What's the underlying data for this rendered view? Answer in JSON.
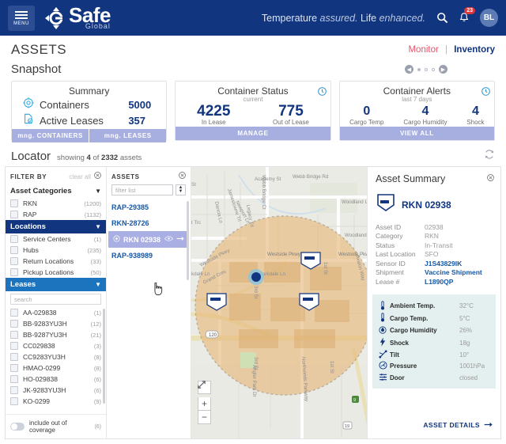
{
  "header": {
    "menu_label": "MENU",
    "logo_text": "Safe",
    "logo_sub": "Global",
    "tagline_1": "Temperature ",
    "tagline_2": "assured.",
    "tagline_3": " Life ",
    "tagline_4": "enhanced.",
    "search_icon": "search-icon",
    "bell_icon": "bell-icon",
    "notification_count": "23",
    "avatar_initials": "BL",
    "brand_navy": "#12357f"
  },
  "page": {
    "title": "ASSETS",
    "nav": {
      "monitor": "Monitor",
      "separator": "|",
      "inventory": "Inventory"
    },
    "snapshot_title": "Snapshot"
  },
  "cards": {
    "summary": {
      "title": "Summary",
      "rows": [
        {
          "label": "Containers",
          "value": "5000",
          "icon": "target-icon"
        },
        {
          "label": "Active Leases",
          "value": "357",
          "icon": "document-check-icon"
        }
      ],
      "actions": [
        "mng. CONTAINERS",
        "mng. LEASES"
      ]
    },
    "container_status": {
      "title": "Container Status",
      "subtitle": "current",
      "stats": [
        {
          "value": "4225",
          "label": "In Lease"
        },
        {
          "value": "775",
          "label": "Out of Lease"
        }
      ],
      "action": "MANAGE"
    },
    "container_alerts": {
      "title": "Container Alerts",
      "subtitle": "last 7 days",
      "stats": [
        {
          "value": "0",
          "label": "Cargo Temp"
        },
        {
          "value": "4",
          "label": "Cargo Humidity"
        },
        {
          "value": "4",
          "label": "Shock"
        }
      ],
      "action": "VIEW ALL"
    }
  },
  "locator": {
    "title": "Locator",
    "showing_prefix": "showing ",
    "showing_count": "4",
    "showing_mid": " of ",
    "showing_total": "2332",
    "showing_suffix": " assets",
    "refresh_icon": "refresh-icon"
  },
  "filter_panel": {
    "heading": "FILTER BY",
    "clear_all": "clear all",
    "close_icon": "close-circle-icon",
    "sections": [
      {
        "title": "Asset Categories",
        "style": "plain",
        "items": [
          {
            "label": "RKN",
            "count": "(1200)"
          },
          {
            "label": "RAP",
            "count": "(1132)"
          }
        ]
      },
      {
        "title": "Locations",
        "style": "navy",
        "items": [
          {
            "label": "Service Centers",
            "count": "(1)"
          },
          {
            "label": "Hubs",
            "count": "(235)"
          },
          {
            "label": "Return Locations",
            "count": "(33)"
          },
          {
            "label": "Pickup Locations",
            "count": "(50)"
          }
        ]
      },
      {
        "title": "Leases",
        "style": "blue",
        "search_placeholder": "search",
        "items": [
          {
            "label": "AA-029838",
            "count": "(1)"
          },
          {
            "label": "BB-9283YU3H",
            "count": "(12)"
          },
          {
            "label": "BB-9287YU3H",
            "count": "(21)"
          },
          {
            "label": "CC029838",
            "count": "(3)"
          },
          {
            "label": "CC9283YU3H",
            "count": "(8)"
          },
          {
            "label": "HMAO-0299",
            "count": "(8)"
          },
          {
            "label": "HO-029838",
            "count": "(6)"
          },
          {
            "label": "JK-9283YU3H",
            "count": "(6)"
          },
          {
            "label": "KO-0299",
            "count": "(9)"
          }
        ]
      }
    ],
    "toggle": {
      "label": "include out of coverage",
      "count": "(6)",
      "on": false
    }
  },
  "asset_list": {
    "heading": "ASSETS",
    "close_icon": "close-circle-icon",
    "filter_placeholder": "filter list",
    "stepper_icon": "sort-stepper-icon",
    "items": [
      {
        "label": "RAP-29385",
        "selected": false
      },
      {
        "label": "RKN-28726",
        "selected": false
      },
      {
        "label": "RKN 02938",
        "selected": true,
        "eye_icon": "eye-icon",
        "go_icon": "arrow-right-icon"
      },
      {
        "label": "RAP-938989",
        "selected": false
      }
    ]
  },
  "map": {
    "labels": [
      "Academy St",
      "Webb Bridge Rd",
      "Webb Bridge Ct",
      "Woodland Ln",
      "Westside Pkwy",
      "Westside Pkwy",
      "Grand Cres",
      "3rd St",
      "1st St",
      "Parkdale Ln",
      "Northwinds Parkway",
      "Avalon Way",
      "Angler Park Dr",
      "Jamestowne Trl",
      "Dancia Ln",
      "Newport Ln",
      "Legacy Trl",
      "Woodland Trc"
    ],
    "shields": [
      "120",
      "9",
      "19"
    ],
    "zoom_in": "+",
    "zoom_out": "−",
    "expand_icon": "expand-icon",
    "marker_icon": "location-dot-icon",
    "container_icon": "container-icon",
    "coverage_color": "#e8b87a"
  },
  "asset_summary": {
    "title": "Asset Summary",
    "close_icon": "close-circle-icon",
    "asset_icon": "container-shield-icon",
    "asset_name": "RKN 02938",
    "fields": [
      {
        "key": "Asset ID",
        "value": "02938",
        "link": false
      },
      {
        "key": "Category",
        "value": "RKN",
        "link": false
      },
      {
        "key": "Status",
        "value": "In-Transit",
        "link": false
      },
      {
        "key": "Last Location",
        "value": "SFO",
        "link": false
      },
      {
        "key": "Sensor ID",
        "value": "J1S43829IK",
        "link": true
      },
      {
        "key": "Shipment",
        "value": "Vaccine Shipment",
        "link": true
      },
      {
        "key": "Lease #",
        "value": "L1890QP",
        "link": true
      }
    ],
    "sensors": [
      {
        "icon": "thermometer-icon",
        "label": "Ambient Temp.",
        "value": "32°C"
      },
      {
        "icon": "thermometer-icon",
        "label": "Cargo Temp.",
        "value": "5°C"
      },
      {
        "icon": "humidity-icon",
        "label": "Cargo Humidity",
        "value": "26%"
      },
      {
        "icon": "shock-icon",
        "label": "Shock",
        "value": "18g"
      },
      {
        "icon": "tilt-icon",
        "label": "Tilt",
        "value": "10°"
      },
      {
        "icon": "pressure-icon",
        "label": "Pressure",
        "value": "1001hPa"
      },
      {
        "icon": "door-icon",
        "label": "Door",
        "value": "closed"
      }
    ],
    "details_link": "ASSET DETAILS",
    "details_arrow": "arrow-right-icon"
  }
}
